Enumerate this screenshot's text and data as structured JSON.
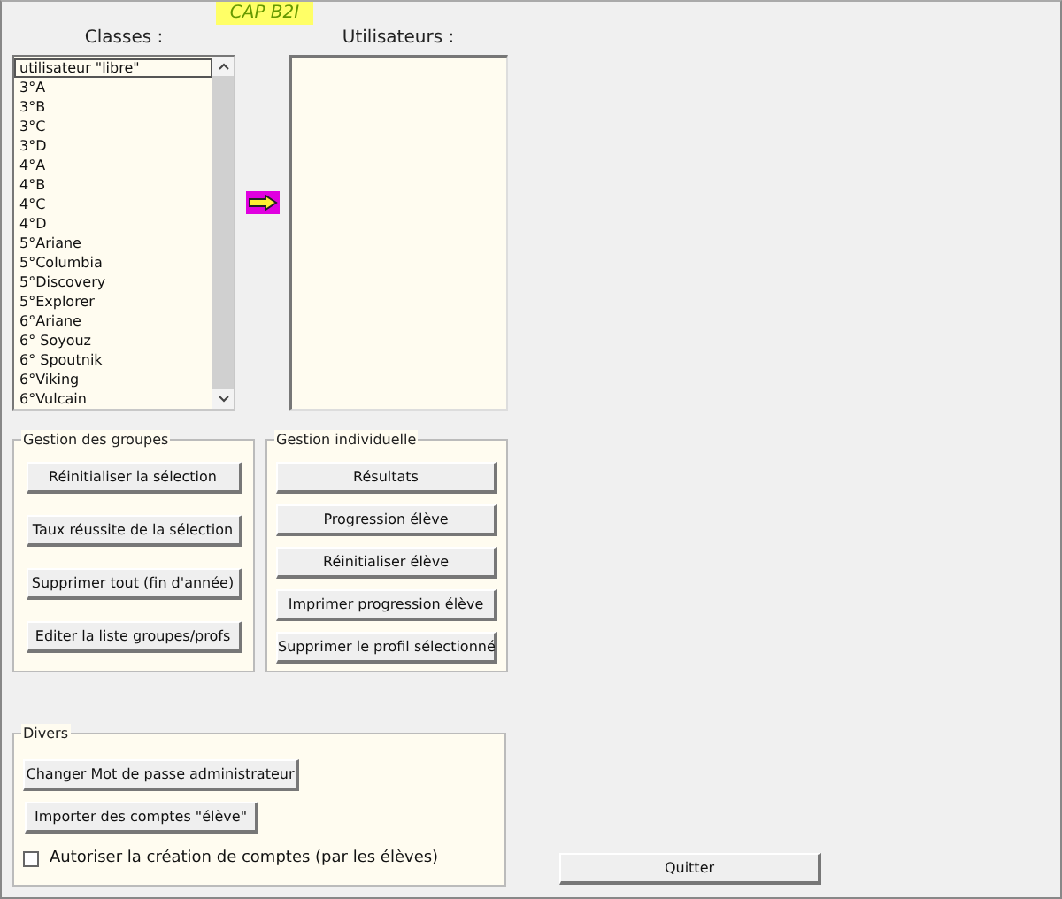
{
  "title": "CAP B2I",
  "classes": {
    "label": "Classes :",
    "items": [
      {
        "text": "utilisateur \"libre\"",
        "selected": true
      },
      {
        "text": "3°A",
        "selected": false
      },
      {
        "text": "3°B",
        "selected": false
      },
      {
        "text": "3°C",
        "selected": false
      },
      {
        "text": "3°D",
        "selected": false
      },
      {
        "text": "4°A",
        "selected": false
      },
      {
        "text": "4°B",
        "selected": false
      },
      {
        "text": "4°C",
        "selected": false
      },
      {
        "text": "4°D",
        "selected": false
      },
      {
        "text": "5°Ariane",
        "selected": false
      },
      {
        "text": "5°Columbia",
        "selected": false
      },
      {
        "text": "5°Discovery",
        "selected": false
      },
      {
        "text": "5°Explorer",
        "selected": false
      },
      {
        "text": "6°Ariane",
        "selected": false
      },
      {
        "text": "6° Soyouz",
        "selected": false
      },
      {
        "text": "6° Spoutnik",
        "selected": false
      },
      {
        "text": "6°Viking",
        "selected": false
      },
      {
        "text": "6°Vulcain",
        "selected": false
      }
    ]
  },
  "users": {
    "label": "Utilisateurs :"
  },
  "groups": {
    "title": "Gestion des groupes",
    "buttons": [
      "Réinitialiser la sélection",
      "Taux réussite de la sélection",
      "Supprimer tout (fin d'année)",
      "Editer la liste groupes/profs"
    ]
  },
  "individual": {
    "title": "Gestion individuelle",
    "buttons": [
      "Résultats",
      "Progression élève",
      "Réinitialiser élève",
      "Imprimer progression élève",
      "Supprimer le profil sélectionné"
    ]
  },
  "misc": {
    "title": "Divers",
    "buttons": [
      "Changer Mot de passe administrateur",
      "Importer des comptes \"élève\""
    ],
    "checkbox": {
      "label": "Autoriser la création de comptes (par les élèves)",
      "checked": false
    }
  },
  "quit": "Quitter"
}
